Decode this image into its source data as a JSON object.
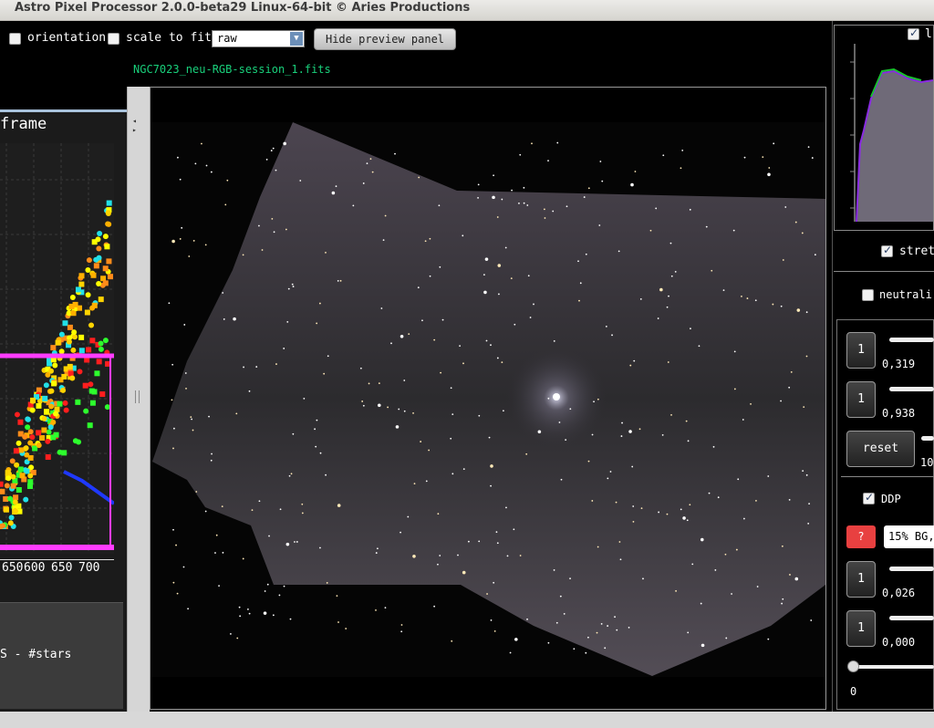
{
  "window": {
    "title": "Astro Pixel Processor 2.0.0-beta29 Linux-64-bit © Aries Productions"
  },
  "toolbar": {
    "orientation_label": "orientation",
    "scale_to_fit_label": "scale to fit",
    "mode_value": "raw",
    "hide_preview_label": "Hide preview panel",
    "filename": "NGC7023_neu-RGB-session_1.fits"
  },
  "left_panel": {
    "title": "frame",
    "x_ticks": [
      "650",
      "600",
      "650",
      "700"
    ],
    "series_label": "S - #stars"
  },
  "chart_data": {
    "type": "scatter",
    "title": "frame",
    "xlabel": "",
    "ylabel": "",
    "x_tick_labels": [
      "650",
      "600",
      "650",
      "700"
    ]
  },
  "right_panel": {
    "histogram_check_label": "l",
    "stretch_label": "stret",
    "neutralize_label": "neutrali",
    "slider1_value": "0,319",
    "slider2_value": "0,938",
    "reset_label": "reset",
    "slider3_value": "10",
    "ddp_label": "DDP",
    "help_label": "?",
    "preset_value": "15% BG,",
    "slider4_value": "0,026",
    "slider5_value": "0,000",
    "slider6_value": "0",
    "btn_one_label": "1"
  }
}
